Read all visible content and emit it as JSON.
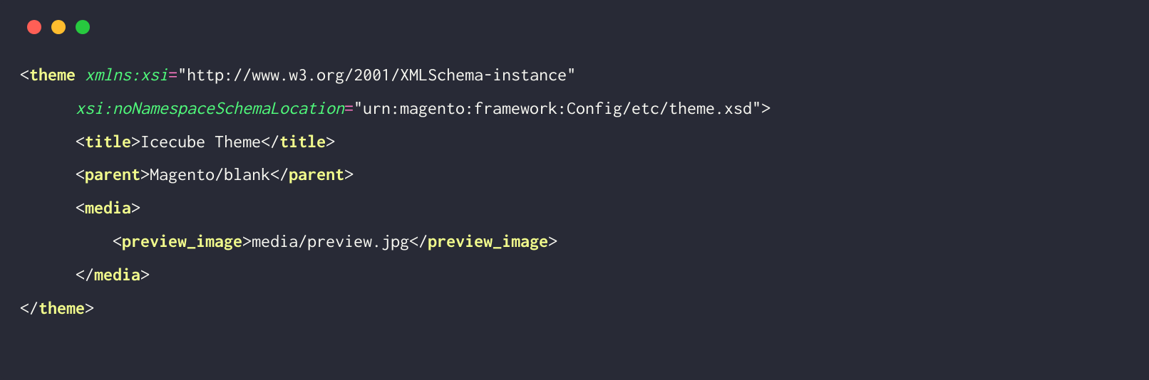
{
  "code": {
    "line1": {
      "tag": "theme",
      "attr": "xmlns:xsi",
      "val": "\"http://www.w3.org/2001/XMLSchema-instance\""
    },
    "line2": {
      "attr": "xsi:noNamespaceSchemaLocation",
      "val": "\"urn:magento:framework:Config/etc/theme.xsd\""
    },
    "line3": {
      "tag": "title",
      "text": "Icecube Theme"
    },
    "line4": {
      "tag": "parent",
      "text": "Magento/blank"
    },
    "line5": {
      "tag": "media"
    },
    "line6": {
      "tag": "preview_image",
      "text": "media/preview.jpg"
    },
    "line7": {
      "tag": "media"
    },
    "line8": {
      "tag": "theme"
    }
  }
}
